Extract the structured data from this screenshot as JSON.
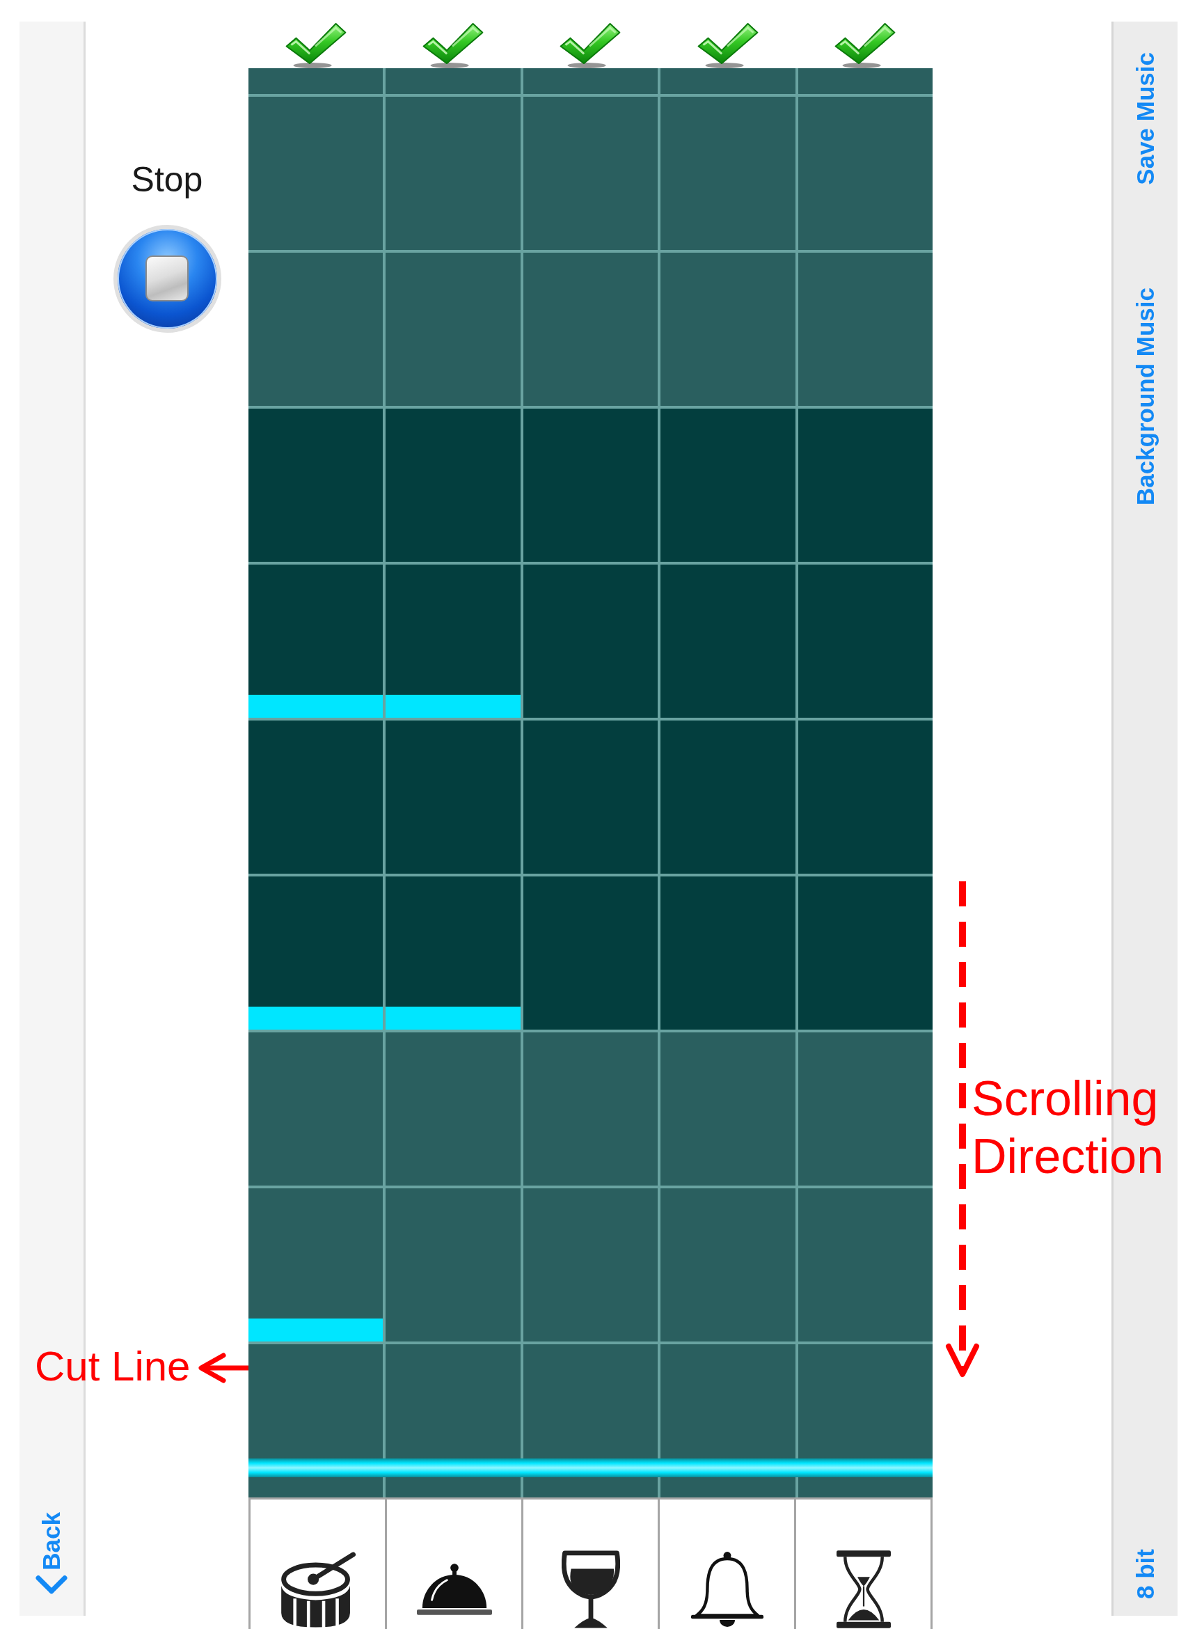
{
  "left_sidebar": {
    "back_button": {
      "label": "Back"
    }
  },
  "stop_control": {
    "label": "Stop"
  },
  "columns": [
    {
      "checked": true
    },
    {
      "checked": true
    },
    {
      "checked": true
    },
    {
      "checked": true
    },
    {
      "checked": true
    }
  ],
  "grid": {
    "rows": [
      {
        "kind": "partial",
        "active": false,
        "notes": [
          false,
          false,
          false,
          false,
          false
        ]
      },
      {
        "kind": "full",
        "active": false,
        "notes": [
          false,
          false,
          false,
          false,
          false
        ]
      },
      {
        "kind": "full",
        "active": false,
        "notes": [
          false,
          false,
          false,
          false,
          false
        ]
      },
      {
        "kind": "full",
        "active": true,
        "notes": [
          false,
          false,
          false,
          false,
          false
        ]
      },
      {
        "kind": "full",
        "active": true,
        "notes": [
          true,
          true,
          false,
          false,
          false
        ]
      },
      {
        "kind": "full",
        "active": true,
        "notes": [
          false,
          false,
          false,
          false,
          false
        ]
      },
      {
        "kind": "full",
        "active": true,
        "notes": [
          true,
          true,
          false,
          false,
          false
        ]
      },
      {
        "kind": "full",
        "active": false,
        "notes": [
          false,
          false,
          false,
          false,
          false
        ]
      },
      {
        "kind": "full",
        "active": false,
        "notes": [
          true,
          false,
          false,
          false,
          false
        ]
      },
      {
        "kind": "partial",
        "active": false,
        "notes": [
          false,
          false,
          false,
          false,
          false
        ]
      }
    ]
  },
  "annotations": [
    {
      "kind": "cut",
      "label": "Cut Line"
    },
    {
      "kind": "scroll",
      "label": "Scrolling Direction"
    }
  ],
  "right_sidebar": {
    "top_items": [
      {
        "label": "Save Music"
      },
      {
        "label": "Background Music"
      }
    ],
    "bottom_items": [
      {
        "label": "8 bit"
      }
    ]
  }
}
